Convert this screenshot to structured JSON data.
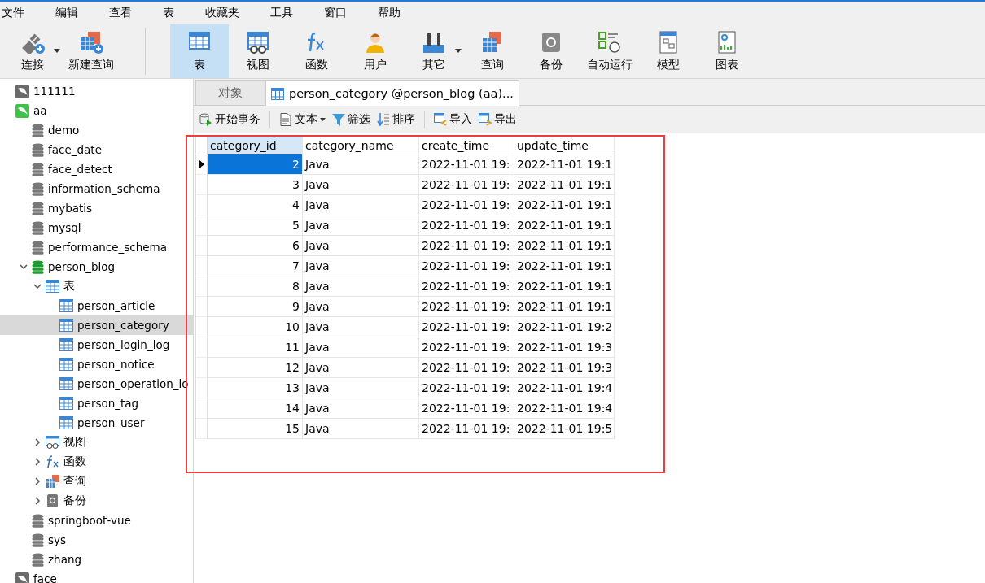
{
  "menu": [
    "文件",
    "编辑",
    "查看",
    "表",
    "收藏夹",
    "工具",
    "窗口",
    "帮助"
  ],
  "toolbar": [
    {
      "label": "连接",
      "dropdown": true,
      "selected": false
    },
    {
      "label": "新建查询",
      "dropdown": false,
      "selected": false
    },
    {
      "label": "表",
      "dropdown": false,
      "selected": true
    },
    {
      "label": "视图",
      "dropdown": false,
      "selected": false
    },
    {
      "label": "函数",
      "dropdown": false,
      "selected": false
    },
    {
      "label": "用户",
      "dropdown": false,
      "selected": false
    },
    {
      "label": "其它",
      "dropdown": true,
      "selected": false
    },
    {
      "label": "查询",
      "dropdown": false,
      "selected": false
    },
    {
      "label": "备份",
      "dropdown": false,
      "selected": false
    },
    {
      "label": "自动运行",
      "dropdown": false,
      "selected": false
    },
    {
      "label": "模型",
      "dropdown": false,
      "selected": false
    },
    {
      "label": "图表",
      "dropdown": false,
      "selected": false
    }
  ],
  "tree": [
    {
      "label": "111111",
      "kind": "connection",
      "open": false,
      "selected": false
    },
    {
      "label": "aa",
      "kind": "connection",
      "open": true,
      "selected": false,
      "children": [
        {
          "label": "demo",
          "kind": "database",
          "open": false,
          "selected": false
        },
        {
          "label": "face_date",
          "kind": "database",
          "open": false,
          "selected": false
        },
        {
          "label": "face_detect",
          "kind": "database",
          "open": false,
          "selected": false
        },
        {
          "label": "information_schema",
          "kind": "database",
          "open": false,
          "selected": false
        },
        {
          "label": "mybatis",
          "kind": "database",
          "open": false,
          "selected": false
        },
        {
          "label": "mysql",
          "kind": "database",
          "open": false,
          "selected": false
        },
        {
          "label": "performance_schema",
          "kind": "database",
          "open": false,
          "selected": false
        },
        {
          "label": "person_blog",
          "kind": "database",
          "open": true,
          "expanded": true,
          "selected": false,
          "children": [
            {
              "label": "表",
              "kind": "tables",
              "expanded": true,
              "selected": false,
              "children": [
                {
                  "label": "person_article",
                  "kind": "table",
                  "selected": false
                },
                {
                  "label": "person_category",
                  "kind": "table",
                  "selected": true
                },
                {
                  "label": "person_login_log",
                  "kind": "table",
                  "selected": false
                },
                {
                  "label": "person_notice",
                  "kind": "table",
                  "selected": false
                },
                {
                  "label": "person_operation_lo",
                  "kind": "table",
                  "selected": false
                },
                {
                  "label": "person_tag",
                  "kind": "table",
                  "selected": false
                },
                {
                  "label": "person_user",
                  "kind": "table",
                  "selected": false
                }
              ]
            },
            {
              "label": "视图",
              "kind": "views",
              "expanded": false,
              "selected": false
            },
            {
              "label": "函数",
              "kind": "functions",
              "expanded": false,
              "selected": false
            },
            {
              "label": "查询",
              "kind": "queries",
              "expanded": false,
              "selected": false
            },
            {
              "label": "备份",
              "kind": "backups",
              "expanded": false,
              "selected": false
            }
          ]
        },
        {
          "label": "springboot-vue",
          "kind": "database",
          "open": false,
          "selected": false
        },
        {
          "label": "sys",
          "kind": "database",
          "open": false,
          "selected": false
        },
        {
          "label": "zhang",
          "kind": "database",
          "open": false,
          "selected": false
        }
      ]
    },
    {
      "label": "face",
      "kind": "connection",
      "open": false,
      "selected": false
    }
  ],
  "tabs": [
    {
      "label": "对象",
      "kind": "objects",
      "selected": false
    },
    {
      "label": "person_category @person_blog (aa)...",
      "kind": "table",
      "selected": true
    }
  ],
  "table_toolbar": [
    {
      "label": "开始事务",
      "dropdown": false
    },
    {
      "label": "文本",
      "dropdown": true
    },
    {
      "label": "筛选",
      "dropdown": false
    },
    {
      "label": "排序",
      "dropdown": false
    },
    {
      "label": "导入",
      "dropdown": false
    },
    {
      "label": "导出",
      "dropdown": false
    }
  ],
  "grid": {
    "columns": [
      {
        "label": "category_id",
        "selected": true
      },
      {
        "label": "category_name",
        "selected": false
      },
      {
        "label": "create_time",
        "selected": false
      },
      {
        "label": "update_time",
        "selected": false
      }
    ],
    "rows": [
      {
        "cells": [
          "2",
          "Java",
          "2022-11-01 19:",
          "2022-11-01 19:1"
        ],
        "selected": true
      },
      {
        "cells": [
          "3",
          "Java",
          "2022-11-01 19:",
          "2022-11-01 19:1"
        ],
        "selected": false
      },
      {
        "cells": [
          "4",
          "Java",
          "2022-11-01 19:",
          "2022-11-01 19:1"
        ],
        "selected": false
      },
      {
        "cells": [
          "5",
          "Java",
          "2022-11-01 19:",
          "2022-11-01 19:1"
        ],
        "selected": false
      },
      {
        "cells": [
          "6",
          "Java",
          "2022-11-01 19:",
          "2022-11-01 19:1"
        ],
        "selected": false
      },
      {
        "cells": [
          "7",
          "Java",
          "2022-11-01 19:",
          "2022-11-01 19:1"
        ],
        "selected": false
      },
      {
        "cells": [
          "8",
          "Java",
          "2022-11-01 19:",
          "2022-11-01 19:1"
        ],
        "selected": false
      },
      {
        "cells": [
          "9",
          "Java",
          "2022-11-01 19:",
          "2022-11-01 19:1"
        ],
        "selected": false
      },
      {
        "cells": [
          "10",
          "Java",
          "2022-11-01 19:",
          "2022-11-01 19:2"
        ],
        "selected": false
      },
      {
        "cells": [
          "11",
          "Java",
          "2022-11-01 19:",
          "2022-11-01 19:3"
        ],
        "selected": false
      },
      {
        "cells": [
          "12",
          "Java",
          "2022-11-01 19:",
          "2022-11-01 19:3"
        ],
        "selected": false
      },
      {
        "cells": [
          "13",
          "Java",
          "2022-11-01 19:",
          "2022-11-01 19:4"
        ],
        "selected": false
      },
      {
        "cells": [
          "14",
          "Java",
          "2022-11-01 19:",
          "2022-11-01 19:4"
        ],
        "selected": false
      },
      {
        "cells": [
          "15",
          "Java",
          "2022-11-01 19:",
          "2022-11-01 19:5"
        ],
        "selected": false
      }
    ]
  }
}
